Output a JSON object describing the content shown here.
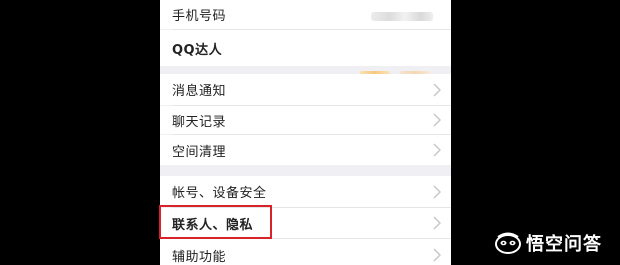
{
  "settings": {
    "items": [
      {
        "label": "手机号码"
      },
      {
        "label": "QQ达人"
      },
      {
        "label": "消息通知"
      },
      {
        "label": "聊天记录"
      },
      {
        "label": "空间清理"
      },
      {
        "label": "帐号、设备安全"
      },
      {
        "label": "联系人、隐私"
      },
      {
        "label": "辅助功能"
      }
    ]
  },
  "watermark": {
    "text": "悟空问答"
  },
  "colors": {
    "background": "#000000",
    "panel": "#f0eff4",
    "row": "#ffffff",
    "highlight": "#d9232b"
  }
}
